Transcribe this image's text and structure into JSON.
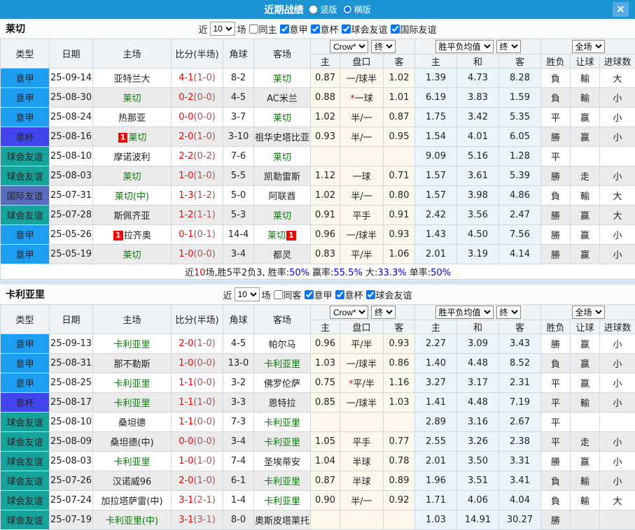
{
  "titlebar": {
    "title": "近期战绩",
    "layout_options": [
      {
        "label": "竖版",
        "selected": false
      },
      {
        "label": "横版",
        "selected": true
      }
    ],
    "close_label": "✕"
  },
  "headers": {
    "main": [
      "类型",
      "日期",
      "主场",
      "比分(半场)",
      "角球",
      "客场"
    ],
    "selects": [
      "Crow*",
      "终",
      "胜平负均值",
      "终",
      "全场"
    ],
    "sub": [
      "主",
      "盘口",
      "客",
      "主",
      "和",
      "客",
      "胜负",
      "让球",
      "进球数"
    ]
  },
  "colors": {
    "titlebar_bg": "#1c93d2",
    "close_btn_bg": "#56ace0",
    "league": {
      "意甲": "#1d9ef0",
      "意杯": "#4245ee",
      "球会友谊": "#16a39c",
      "国际友谊": "#5a6cc0"
    },
    "win": "#e60000",
    "draw": "#0000e6",
    "lose": "#008000"
  },
  "sections": [
    {
      "team": "莱切",
      "filters": {
        "near": "近",
        "count": "10",
        "games": "场",
        "same": {
          "label": "同主",
          "checked": false
        },
        "leagues": [
          {
            "label": "意甲",
            "checked": true
          },
          {
            "label": "意杯",
            "checked": true
          },
          {
            "label": "球会友谊",
            "checked": true
          },
          {
            "label": "国际友谊",
            "checked": true
          }
        ]
      },
      "rows": [
        {
          "type": "意甲",
          "date": "25-09-14",
          "home": {
            "name": "亚特兰大"
          },
          "ft": "4-1",
          "ht": "(1-0)",
          "corner": "8-2",
          "away": {
            "name": "莱切",
            "green": true
          },
          "odds": [
            "0.87",
            "一/球半",
            "1.02"
          ],
          "star": false,
          "avg": [
            "1.39",
            "4.73",
            "8.28"
          ],
          "res": [
            [
              "負",
              "g"
            ],
            [
              "輸",
              "g"
            ],
            [
              "大",
              "r"
            ]
          ]
        },
        {
          "type": "意甲",
          "date": "25-08-30",
          "home": {
            "name": "莱切",
            "green": true
          },
          "ft": "0-2",
          "ht": "(0-0)",
          "corner": "4-5",
          "away": {
            "name": "AC米兰"
          },
          "odds": [
            "0.88",
            "一球",
            "1.01"
          ],
          "star": true,
          "avg": [
            "6.19",
            "3.83",
            "1.59"
          ],
          "res": [
            [
              "負",
              "g"
            ],
            [
              "輸",
              "g"
            ],
            [
              "小",
              "g"
            ]
          ]
        },
        {
          "type": "意甲",
          "date": "25-08-24",
          "home": {
            "name": "热那亚"
          },
          "ft": "0-0",
          "ht": "(0-0)",
          "corner": "3-7",
          "away": {
            "name": "莱切",
            "green": true
          },
          "odds": [
            "1.02",
            "半/一",
            "0.87"
          ],
          "star": false,
          "avg": [
            "1.75",
            "3.42",
            "5.35"
          ],
          "res": [
            [
              "平",
              "b"
            ],
            [
              "赢",
              "r"
            ],
            [
              "小",
              "g"
            ]
          ]
        },
        {
          "type": "意杯",
          "date": "25-08-16",
          "home": {
            "name": "莱切",
            "green": true,
            "badge": "1",
            "badge_pos": "before"
          },
          "ft": "2-0",
          "ht": "(1-0)",
          "corner": "3-10",
          "away": {
            "name": "祖华史塔比亚"
          },
          "odds": [
            "0.93",
            "半/一",
            "0.95"
          ],
          "star": false,
          "avg": [
            "1.54",
            "4.01",
            "6.05"
          ],
          "res": [
            [
              "勝",
              "r"
            ],
            [
              "赢",
              "r"
            ],
            [
              "小",
              "g"
            ]
          ]
        },
        {
          "type": "球会友谊",
          "date": "25-08-10",
          "home": {
            "name": "摩诺波利"
          },
          "ft": "2-2",
          "ht": "(0-2)",
          "corner": "7-6",
          "away": {
            "name": "莱切",
            "green": true
          },
          "odds": [
            "",
            "",
            ""
          ],
          "star": false,
          "avg": [
            "9.09",
            "5.16",
            "1.28"
          ],
          "res": [
            [
              "平",
              "b"
            ],
            [
              "",
              ""
            ],
            [
              "",
              ""
            ]
          ]
        },
        {
          "type": "球会友谊",
          "date": "25-08-03",
          "home": {
            "name": "莱切",
            "green": true
          },
          "ft": "1-0",
          "ht": "(1-0)",
          "corner": "5-5",
          "away": {
            "name": "凯勒雷斯"
          },
          "odds": [
            "1.12",
            "一球",
            "0.71"
          ],
          "star": false,
          "avg": [
            "1.57",
            "3.61",
            "5.39"
          ],
          "res": [
            [
              "勝",
              "r"
            ],
            [
              "走",
              "b"
            ],
            [
              "小",
              "g"
            ]
          ]
        },
        {
          "type": "国际友谊",
          "date": "25-07-31",
          "home": {
            "name": "莱切(中)",
            "green": true
          },
          "ft": "1-3",
          "ht": "(1-2)",
          "corner": "5-0",
          "away": {
            "name": "阿联酋"
          },
          "odds": [
            "1.02",
            "半/一",
            "0.80"
          ],
          "star": false,
          "avg": [
            "1.57",
            "3.98",
            "4.86"
          ],
          "res": [
            [
              "負",
              "g"
            ],
            [
              "輸",
              "g"
            ],
            [
              "大",
              "r"
            ]
          ]
        },
        {
          "type": "球会友谊",
          "date": "25-07-28",
          "home": {
            "name": "斯佩齐亚"
          },
          "ft": "1-2",
          "ht": "(1-1)",
          "corner": "5-3",
          "away": {
            "name": "莱切",
            "green": true
          },
          "odds": [
            "0.91",
            "平手",
            "0.91"
          ],
          "star": false,
          "avg": [
            "2.42",
            "3.56",
            "2.47"
          ],
          "res": [
            [
              "勝",
              "r"
            ],
            [
              "赢",
              "r"
            ],
            [
              "大",
              "r"
            ]
          ]
        },
        {
          "type": "意甲",
          "date": "25-05-26",
          "home": {
            "name": "拉齐奥",
            "badge": "1",
            "badge_pos": "before"
          },
          "ft": "0-1",
          "ht": "(0-1)",
          "corner": "14-4",
          "away": {
            "name": "莱切",
            "green": true,
            "badge": "1",
            "badge_pos": "after"
          },
          "odds": [
            "0.96",
            "一/球半",
            "0.93"
          ],
          "star": false,
          "avg": [
            "1.43",
            "4.50",
            "7.56"
          ],
          "res": [
            [
              "勝",
              "r"
            ],
            [
              "赢",
              "r"
            ],
            [
              "小",
              "g"
            ]
          ]
        },
        {
          "type": "意甲",
          "date": "25-05-19",
          "home": {
            "name": "莱切",
            "green": true
          },
          "ft": "1-0",
          "ht": "(0-0)",
          "corner": "3-4",
          "away": {
            "name": "都灵"
          },
          "odds": [
            "0.83",
            "平/半",
            "1.06"
          ],
          "star": false,
          "avg": [
            "2.01",
            "3.19",
            "4.14"
          ],
          "res": [
            [
              "勝",
              "r"
            ],
            [
              "赢",
              "r"
            ],
            [
              "小",
              "g"
            ]
          ]
        }
      ],
      "summary": [
        {
          "t": "近",
          "c": ""
        },
        {
          "t": "10",
          "c": "r"
        },
        {
          "t": "场,胜5平2负3, 胜率:",
          "c": ""
        },
        {
          "t": "50%",
          "c": "b"
        },
        {
          "t": " 赢率:",
          "c": ""
        },
        {
          "t": "55.5%",
          "c": "b"
        },
        {
          "t": " 大:",
          "c": ""
        },
        {
          "t": "33.3%",
          "c": "b"
        },
        {
          "t": " 单率:",
          "c": ""
        },
        {
          "t": "50%",
          "c": "b"
        }
      ]
    },
    {
      "team": "卡利亚里",
      "filters": {
        "near": "近",
        "count": "10",
        "games": "场",
        "same": {
          "label": "同客",
          "checked": false
        },
        "leagues": [
          {
            "label": "意甲",
            "checked": true
          },
          {
            "label": "意杯",
            "checked": true
          },
          {
            "label": "球会友谊",
            "checked": true
          }
        ]
      },
      "rows": [
        {
          "type": "意甲",
          "date": "25-09-13",
          "home": {
            "name": "卡利亚里",
            "green": true
          },
          "ft": "2-0",
          "ht": "(1-0)",
          "corner": "4-5",
          "away": {
            "name": "帕尔马"
          },
          "odds": [
            "0.96",
            "平/半",
            "0.93"
          ],
          "star": false,
          "avg": [
            "2.27",
            "3.09",
            "3.43"
          ],
          "res": [
            [
              "勝",
              "r"
            ],
            [
              "赢",
              "r"
            ],
            [
              "小",
              "g"
            ]
          ]
        },
        {
          "type": "意甲",
          "date": "25-08-31",
          "home": {
            "name": "那不勒斯"
          },
          "ft": "1-0",
          "ht": "(0-0)",
          "corner": "13-0",
          "away": {
            "name": "卡利亚里",
            "green": true
          },
          "odds": [
            "1.03",
            "一/球半",
            "0.86"
          ],
          "star": false,
          "avg": [
            "1.40",
            "4.48",
            "8.52"
          ],
          "res": [
            [
              "負",
              "g"
            ],
            [
              "赢",
              "r"
            ],
            [
              "小",
              "g"
            ]
          ]
        },
        {
          "type": "意甲",
          "date": "25-08-25",
          "home": {
            "name": "卡利亚里",
            "green": true
          },
          "ft": "1-1",
          "ht": "(0-0)",
          "corner": "3-2",
          "away": {
            "name": "佛罗伦萨"
          },
          "odds": [
            "0.75",
            "平/半",
            "1.16"
          ],
          "star": true,
          "avg": [
            "3.27",
            "3.17",
            "2.31"
          ],
          "res": [
            [
              "平",
              "b"
            ],
            [
              "赢",
              "r"
            ],
            [
              "小",
              "g"
            ]
          ]
        },
        {
          "type": "意杯",
          "date": "25-08-17",
          "home": {
            "name": "卡利亚里",
            "green": true
          },
          "ft": "1-1",
          "ht": "(1-0)",
          "corner": "3-3",
          "away": {
            "name": "恩特拉"
          },
          "odds": [
            "0.85",
            "一/球半",
            "1.03"
          ],
          "star": false,
          "avg": [
            "1.41",
            "4.48",
            "7.19"
          ],
          "res": [
            [
              "平",
              "b"
            ],
            [
              "輸",
              "g"
            ],
            [
              "小",
              "g"
            ]
          ]
        },
        {
          "type": "球会友谊",
          "date": "25-08-10",
          "home": {
            "name": "桑坦德"
          },
          "ft": "1-1",
          "ht": "(0-0)",
          "corner": "7-3",
          "away": {
            "name": "卡利亚里",
            "green": true
          },
          "odds": [
            "",
            "",
            ""
          ],
          "star": false,
          "avg": [
            "2.89",
            "3.16",
            "2.67"
          ],
          "res": [
            [
              "平",
              "b"
            ],
            [
              "",
              ""
            ],
            [
              "",
              ""
            ]
          ]
        },
        {
          "type": "球会友谊",
          "date": "25-08-09",
          "home": {
            "name": "桑坦德(中)"
          },
          "ft": "0-0",
          "ht": "(0-0)",
          "corner": "3-4",
          "away": {
            "name": "卡利亚里",
            "green": true
          },
          "odds": [
            "1.05",
            "平手",
            "0.77"
          ],
          "star": false,
          "avg": [
            "2.55",
            "3.26",
            "2.38"
          ],
          "res": [
            [
              "平",
              "b"
            ],
            [
              "走",
              "b"
            ],
            [
              "小",
              "g"
            ]
          ]
        },
        {
          "type": "球会友谊",
          "date": "25-08-03",
          "home": {
            "name": "卡利亚里",
            "green": true
          },
          "ft": "1-0",
          "ht": "(1-0)",
          "corner": "7-4",
          "away": {
            "name": "圣埃蒂安"
          },
          "odds": [
            "1.04",
            "半球",
            "0.78"
          ],
          "star": false,
          "avg": [
            "2.01",
            "3.50",
            "3.31"
          ],
          "res": [
            [
              "勝",
              "r"
            ],
            [
              "赢",
              "r"
            ],
            [
              "小",
              "g"
            ]
          ]
        },
        {
          "type": "球会友谊",
          "date": "25-07-26",
          "home": {
            "name": "汉诺威96"
          },
          "ft": "2-0",
          "ht": "(1-0)",
          "corner": "6-1",
          "away": {
            "name": "卡利亚里",
            "green": true
          },
          "odds": [
            "0.87",
            "半球",
            "0.89"
          ],
          "star": false,
          "avg": [
            "1.96",
            "3.51",
            "3.41"
          ],
          "res": [
            [
              "負",
              "g"
            ],
            [
              "輸",
              "g"
            ],
            [
              "小",
              "g"
            ]
          ]
        },
        {
          "type": "球会友谊",
          "date": "25-07-24",
          "home": {
            "name": "加拉塔萨雷(中)"
          },
          "ft": "3-1",
          "ht": "(2-1)",
          "corner": "1-4",
          "away": {
            "name": "卡利亚里",
            "green": true
          },
          "odds": [
            "0.90",
            "半/一",
            "0.92"
          ],
          "star": false,
          "avg": [
            "1.71",
            "4.06",
            "4.04"
          ],
          "res": [
            [
              "負",
              "g"
            ],
            [
              "輸",
              "g"
            ],
            [
              "大",
              "r"
            ]
          ]
        },
        {
          "type": "球会友谊",
          "date": "25-07-19",
          "home": {
            "name": "卡利亚里(中)",
            "green": true
          },
          "ft": "3-1",
          "ht": "(3-1)",
          "corner": "8-0",
          "away": {
            "name": "奥斯皮塔莱托"
          },
          "odds": [
            "",
            "",
            ""
          ],
          "star": false,
          "avg": [
            "1.03",
            "14.91",
            "30.27"
          ],
          "res": [
            [
              "勝",
              "r"
            ],
            [
              "",
              ""
            ],
            [
              "",
              ""
            ]
          ]
        }
      ],
      "summary": null
    }
  ]
}
